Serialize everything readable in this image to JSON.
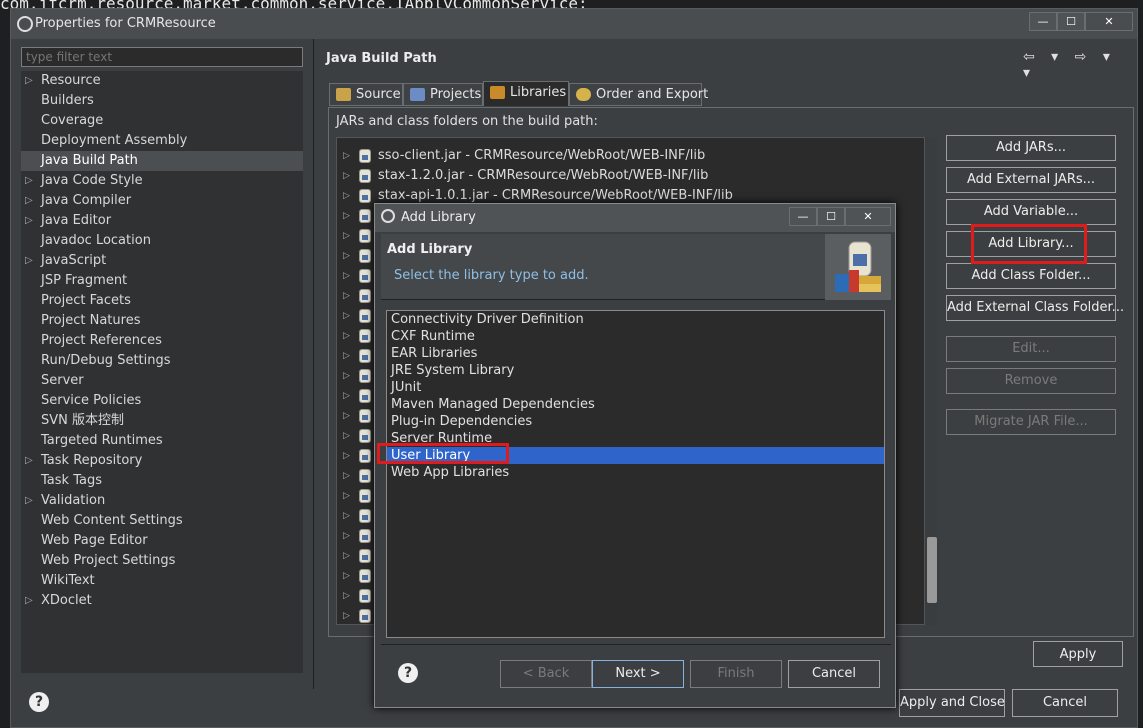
{
  "background_code": "com.jfcrm.resource.market.common.service.IApplyCommonService;",
  "window": {
    "title": "Properties for CRMResource",
    "buttons": {
      "minimize": "—",
      "maximize": "☐",
      "close": "✕"
    }
  },
  "filter": {
    "placeholder": "type filter text"
  },
  "nav": {
    "items": [
      {
        "label": "Resource",
        "expandable": true
      },
      {
        "label": "Builders",
        "expandable": false
      },
      {
        "label": "Coverage",
        "expandable": false
      },
      {
        "label": "Deployment Assembly",
        "expandable": false
      },
      {
        "label": "Java Build Path",
        "expandable": false,
        "selected": true
      },
      {
        "label": "Java Code Style",
        "expandable": true
      },
      {
        "label": "Java Compiler",
        "expandable": true
      },
      {
        "label": "Java Editor",
        "expandable": true
      },
      {
        "label": "Javadoc Location",
        "expandable": false
      },
      {
        "label": "JavaScript",
        "expandable": true
      },
      {
        "label": "JSP Fragment",
        "expandable": false
      },
      {
        "label": "Project Facets",
        "expandable": false
      },
      {
        "label": "Project Natures",
        "expandable": false
      },
      {
        "label": "Project References",
        "expandable": false
      },
      {
        "label": "Run/Debug Settings",
        "expandable": false
      },
      {
        "label": "Server",
        "expandable": false
      },
      {
        "label": "Service Policies",
        "expandable": false
      },
      {
        "label": "SVN 版本控制",
        "expandable": false
      },
      {
        "label": "Targeted Runtimes",
        "expandable": false
      },
      {
        "label": "Task Repository",
        "expandable": true
      },
      {
        "label": "Task Tags",
        "expandable": false
      },
      {
        "label": "Validation",
        "expandable": true
      },
      {
        "label": "Web Content Settings",
        "expandable": false
      },
      {
        "label": "Web Page Editor",
        "expandable": false
      },
      {
        "label": "Web Project Settings",
        "expandable": false
      },
      {
        "label": "WikiText",
        "expandable": false
      },
      {
        "label": "XDoclet",
        "expandable": true
      }
    ]
  },
  "panel": {
    "title": "Java Build Path",
    "nav_arrows": "⇦ ▾ ⇨ ▾ ▾",
    "tabs": [
      {
        "label": "Source",
        "icon": "source-folder-icon"
      },
      {
        "label": "Projects",
        "icon": "projects-icon"
      },
      {
        "label": "Libraries",
        "icon": "libraries-icon",
        "active": true
      },
      {
        "label": "Order and Export",
        "icon": "order-export-icon"
      }
    ],
    "jars_label": "JARs and class folders on the build path:",
    "jars": [
      "sso-client.jar - CRMResource/WebRoot/WEB-INF/lib",
      "stax-1.2.0.jar - CRMResource/WebRoot/WEB-INF/lib",
      "stax-api-1.0.1.jar - CRMResource/WebRoot/WEB-INF/lib"
    ],
    "buttons": [
      {
        "label": "Add JARs...",
        "enabled": true
      },
      {
        "label": "Add External JARs...",
        "enabled": true
      },
      {
        "label": "Add Variable...",
        "enabled": true
      },
      {
        "label": "Add Library...",
        "enabled": true,
        "highlighted": true
      },
      {
        "label": "Add Class Folder...",
        "enabled": true
      },
      {
        "label": "Add External Class Folder...",
        "enabled": true
      },
      {
        "label": "Edit...",
        "enabled": false
      },
      {
        "label": "Remove",
        "enabled": false
      },
      {
        "label": "Migrate JAR File...",
        "enabled": false
      }
    ],
    "apply": "Apply"
  },
  "footer": {
    "help": "?",
    "apply_close": "Apply and Close",
    "cancel": "Cancel"
  },
  "dialog": {
    "title": "Add Library",
    "buttons": {
      "minimize": "—",
      "maximize": "☐",
      "close": "✕"
    },
    "header_title": "Add Library",
    "header_subtitle": "Select the library type to add.",
    "library_types": [
      "Connectivity Driver Definition",
      "CXF Runtime",
      "EAR Libraries",
      "JRE System Library",
      "JUnit",
      "Maven Managed Dependencies",
      "Plug-in Dependencies",
      "Server Runtime",
      "User Library",
      "Web App Libraries"
    ],
    "selected": "User Library",
    "help": "?",
    "back": "< Back",
    "next": "Next >",
    "finish": "Finish",
    "cancel": "Cancel"
  },
  "colors": {
    "highlight_box": "#e01b1b",
    "selection": "#2f65ca",
    "subtitle": "#8fbfe4"
  }
}
